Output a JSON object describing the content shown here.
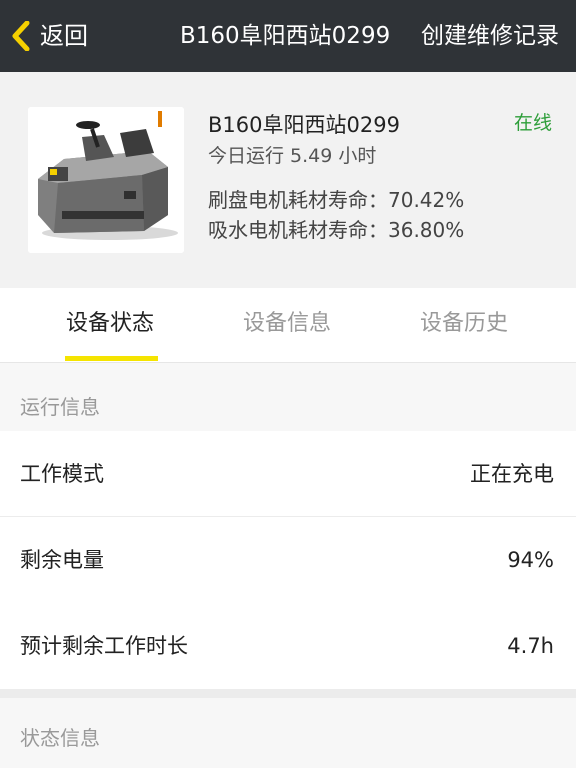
{
  "header": {
    "back_label": "返回",
    "title": "B160阜阳西站0299",
    "action_label": "创建维修记录",
    "accent_color": "#f5d000"
  },
  "device": {
    "name": "B160阜阳西站0299",
    "runtime": "今日运行 5.49 小时",
    "status": "在线",
    "status_color": "#2e9e3a",
    "brush_motor_life": "刷盘电机耗材寿命：70.42%",
    "suction_motor_life": "吸水电机耗材寿命：36.80%"
  },
  "tabs": [
    {
      "label": "设备状态",
      "active": true
    },
    {
      "label": "设备信息",
      "active": false
    },
    {
      "label": "设备历史",
      "active": false
    }
  ],
  "run_info": {
    "title": "运行信息",
    "rows": [
      {
        "label": "工作模式",
        "value": "正在充电"
      },
      {
        "label": "剩余电量",
        "value": "94%"
      },
      {
        "label": "预计剩余工作时长",
        "value": "4.7h"
      }
    ]
  },
  "status_info": {
    "title": "状态信息"
  }
}
